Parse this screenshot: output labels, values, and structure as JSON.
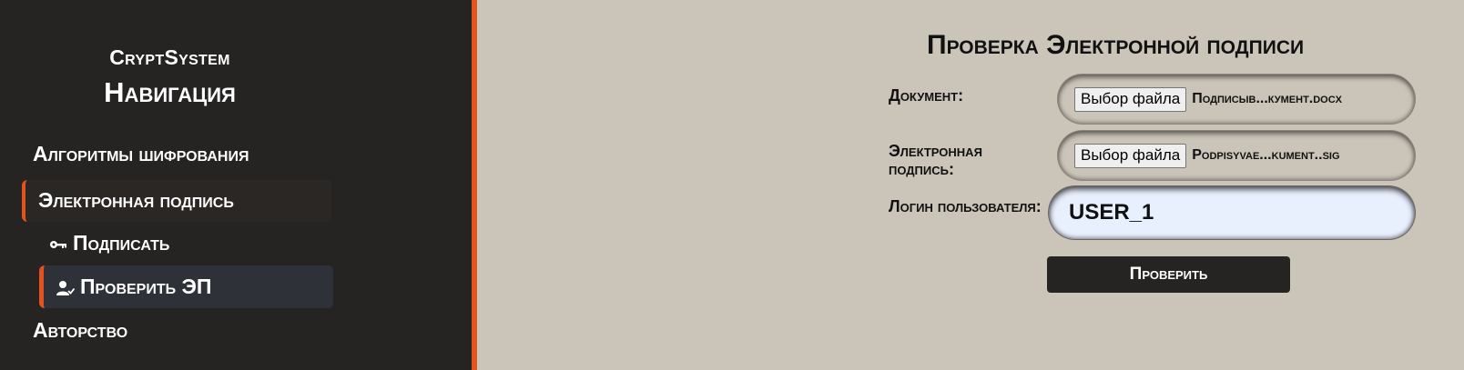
{
  "sidebar": {
    "brand": "CryptSystem",
    "title": "Навигация",
    "items": [
      {
        "label": "Алгоритмы шифрования"
      },
      {
        "label": "Электронная подпись"
      },
      {
        "label": "Подписать",
        "icon": "key-icon"
      },
      {
        "label": "Проверить ЭП",
        "icon": "user-check-icon"
      },
      {
        "label": "Авторство"
      }
    ]
  },
  "main": {
    "title": "Проверка Электронной подписи",
    "document": {
      "label": "Документ:",
      "button": "Выбор файла",
      "filename": "Подписыв...кумент.docx"
    },
    "signature": {
      "label": "Электронная подпись:",
      "button": "Выбор файла",
      "filename": "Podpisyvae...kument..sig"
    },
    "login": {
      "label": "Логин пользователя:",
      "value": "USER_1"
    },
    "submit": "Проверить"
  },
  "colors": {
    "sidebar_bg": "#262423",
    "accent": "#e4531d",
    "main_bg": "#cbc4b9",
    "active_item_bg": "#2e3138"
  }
}
